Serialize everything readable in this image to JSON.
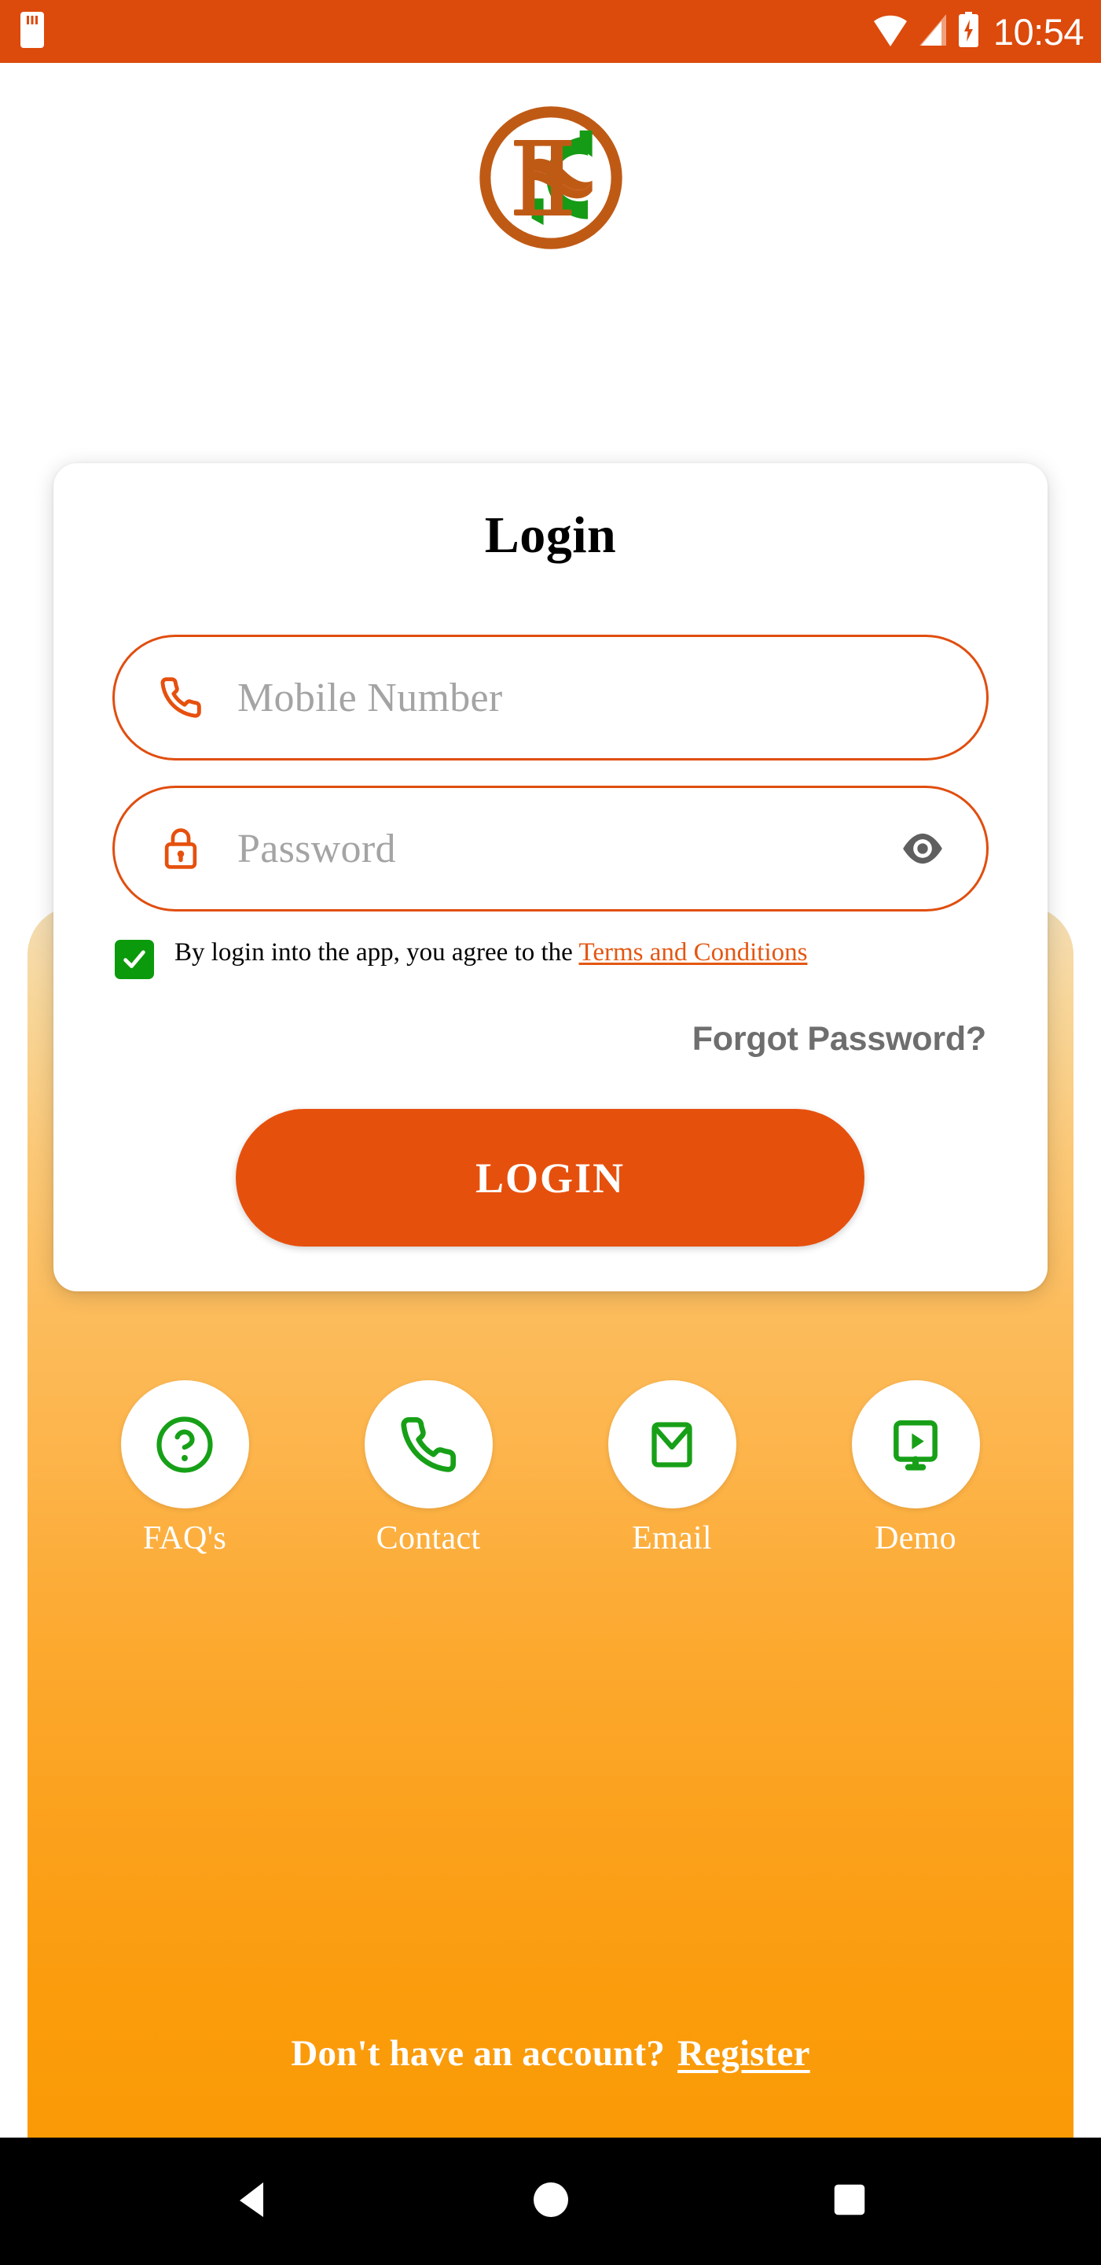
{
  "status_bar": {
    "time": "10:54",
    "background_color": "#DC4A0C",
    "icons": [
      "sim-card-icon",
      "wifi-icon",
      "signal-icon",
      "battery-charging-icon"
    ]
  },
  "brand": {
    "logo_name": "isc-monogram-logo",
    "ring_color": "#BF5A15",
    "letter_color": "#BF5A15",
    "accent_color": "#169B16"
  },
  "card": {
    "title": "Login"
  },
  "form": {
    "mobile": {
      "placeholder": "Mobile Number",
      "value": "",
      "icon": "phone-icon"
    },
    "password": {
      "placeholder": "Password",
      "value": "",
      "icon": "lock-icon",
      "toggle_icon": "eye-icon"
    },
    "terms": {
      "checked": true,
      "text": "By login into the app, you agree to the ",
      "link_label": "Terms and Conditions"
    },
    "forgot_password_label": "Forgot Password?",
    "submit_label": "LOGIN"
  },
  "quick_actions": [
    {
      "label": "FAQ's",
      "icon": "help-circle-icon"
    },
    {
      "label": "Contact",
      "icon": "phone-icon"
    },
    {
      "label": "Email",
      "icon": "envelope-icon"
    },
    {
      "label": "Demo",
      "icon": "device-play-icon"
    }
  ],
  "footer": {
    "prompt": "Don't have an account?",
    "register_label": "Register"
  },
  "nav_bar": {
    "back": "back-triangle-icon",
    "home": "home-circle-icon",
    "recents": "recents-square-icon"
  },
  "colors": {
    "primary_orange": "#E6500D",
    "status_orange": "#DC4A0C",
    "panel_top": "#F3DDB5",
    "panel_bottom": "#FA9A05",
    "green": "#0B9A0B",
    "link_orange": "#E45712",
    "placeholder_grey": "#A4A4A4",
    "muted_grey": "#6E6E6E"
  }
}
